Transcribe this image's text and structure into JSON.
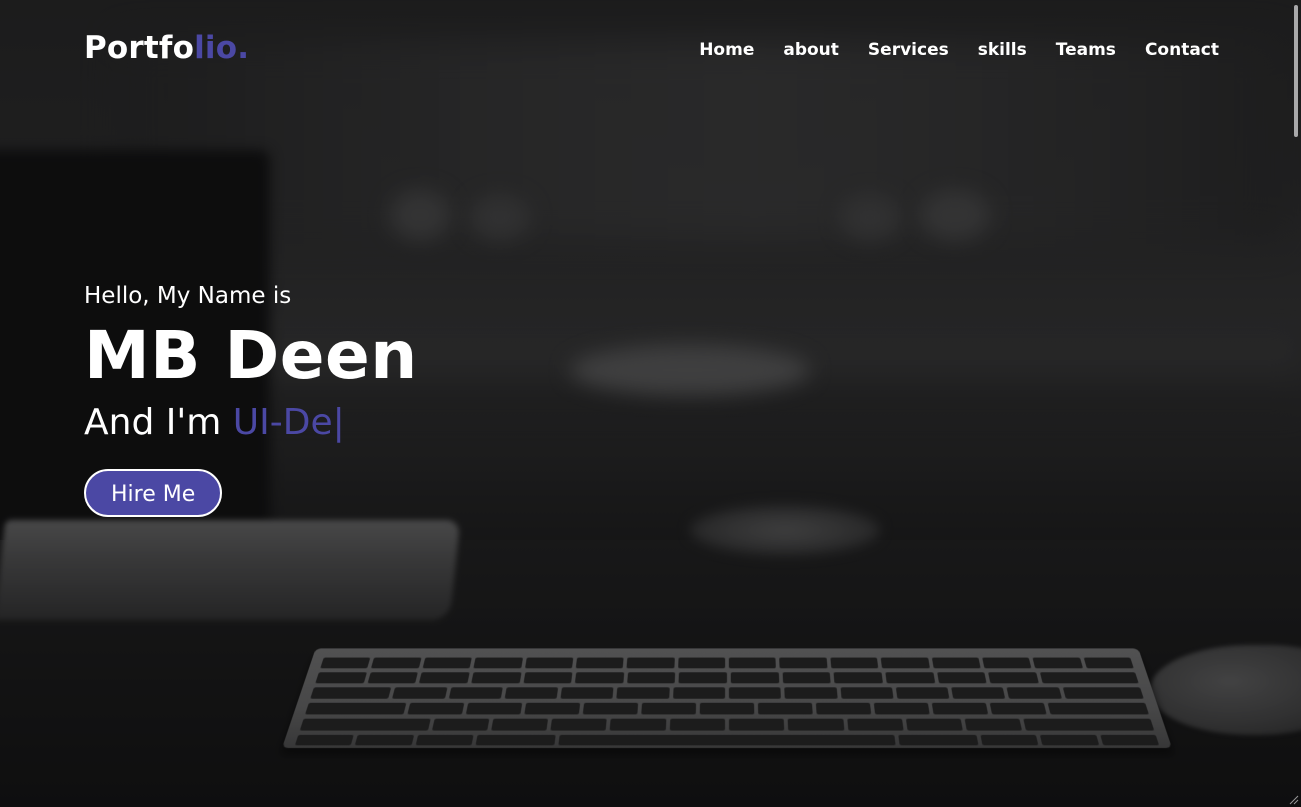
{
  "brand": {
    "logo_main": "Portfo",
    "logo_accent": "lio."
  },
  "nav": {
    "items": [
      "Home",
      "about",
      "Services",
      "skills",
      "Teams",
      "Contact"
    ]
  },
  "hero": {
    "greeting": "Hello, My Name is",
    "name": "MB Deen",
    "role_prefix": "And I'm",
    "role_typed": "UI-De",
    "cursor": "|",
    "cta_label": "Hire Me"
  },
  "colors": {
    "accent": "#4b48a4",
    "text": "#ffffff"
  },
  "icons": {
    "resize_grip": "resize-grip-icon"
  }
}
